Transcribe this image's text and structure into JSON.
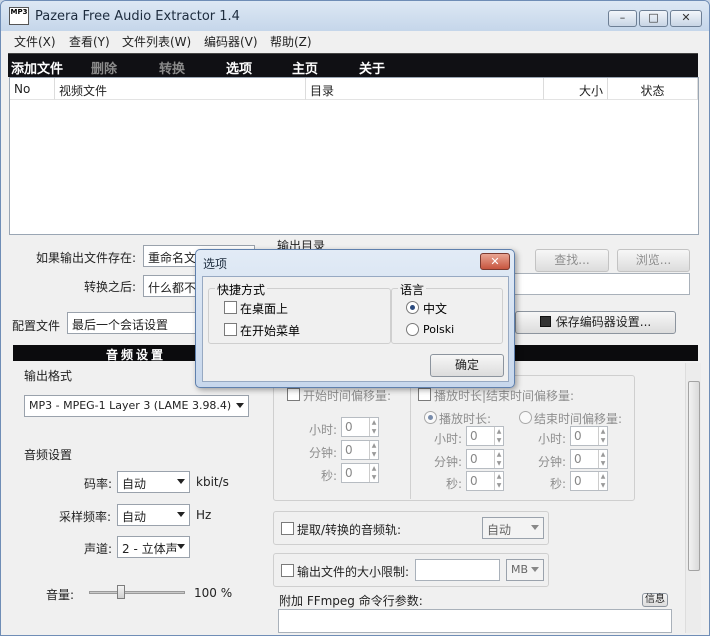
{
  "window": {
    "title": "Pazera Free Audio Extractor 1.4",
    "icon_text": "MP3",
    "buttons": {
      "min": "–",
      "max": "□",
      "close": "✕"
    }
  },
  "menu": [
    "文件(X)",
    "查看(Y)",
    "文件列表(W)",
    "编码器(V)",
    "帮助(Z)"
  ],
  "toolbar": {
    "add": "添加文件",
    "delete": "删除",
    "convert": "转换",
    "options": "选项",
    "home": "主页",
    "about": "关于"
  },
  "list": {
    "columns": [
      "No",
      "视频文件",
      "目录",
      "大小",
      "状态"
    ]
  },
  "output": {
    "if_exists_label": "如果输出文件存在:",
    "if_exists_value": "重命名文",
    "after_label": "转换之后:",
    "after_value": "什么都不",
    "dir_label": "输出目录",
    "find_button": "查找...",
    "browse_button": "浏览..."
  },
  "profile": {
    "label": "配置文件",
    "value": "最后一个会话设置",
    "save_button": "保存编码器设置..."
  },
  "audio": {
    "header": "音频设置",
    "format_label": "输出格式",
    "format_value": "MP3 - MPEG-1 Layer 3 (LAME 3.98.4)",
    "settings_label": "音频设置",
    "bitrate_label": "码率:",
    "bitrate_value": "自动",
    "bitrate_unit": "kbit/s",
    "samplerate_label": "采样频率:",
    "samplerate_value": "自动",
    "samplerate_unit": "Hz",
    "channel_label": "声道:",
    "channel_value": "2 - 立体声",
    "volume_label": "音量:",
    "volume_value": "100 %",
    "volume_level": 100
  },
  "right": {
    "start_offset": "开始时间偏移量:",
    "duration_offset": "播放时长|结束时间偏移量:",
    "duration_radio": "播放时长:",
    "end_radio": "结束时间偏移量:",
    "hours": "小时:",
    "minutes": "分钟:",
    "seconds": "秒:",
    "zero": "0",
    "extract_track": "提取/转换的音频轨:",
    "track_value": "自动",
    "size_limit": "输出文件的大小限制:",
    "size_unit": "MB",
    "ffmpeg_label": "附加 FFmpeg 命令行参数:",
    "info_button": "信息"
  },
  "dialog": {
    "title": "选项",
    "shortcuts_group": "快捷方式",
    "desktop": "在桌面上",
    "startmenu": "在开始菜单",
    "language_group": "语言",
    "lang_chinese": "中文",
    "lang_polish": "Polski",
    "ok": "确定",
    "close": "✕"
  }
}
